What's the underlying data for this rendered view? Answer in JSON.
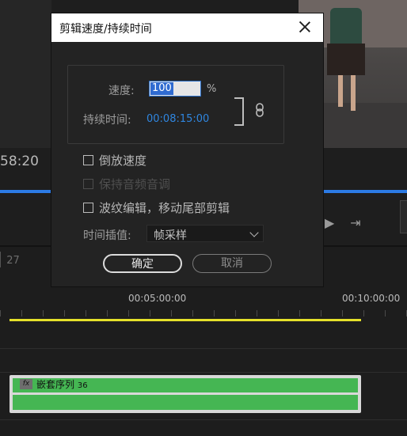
{
  "background": {
    "timecode": "58:20",
    "sequence_marker": "27",
    "ruler": {
      "mark1": "00:05:00:00",
      "mark2": "00:10:00:00"
    },
    "clip": {
      "fx": "fx",
      "name": "嵌套序列",
      "number": "36"
    },
    "colors": {
      "accent": "#2c7be5",
      "work_area": "#e5e02a",
      "clip": "#45b653"
    }
  },
  "dialog": {
    "title": "剪辑速度/持续时间",
    "speed_label": "速度:",
    "speed_value": "100",
    "percent": "%",
    "duration_label": "持续时间:",
    "duration_value": "00:08:15:00",
    "checkboxes": [
      {
        "label": "倒放速度",
        "checked": false,
        "enabled": true
      },
      {
        "label": "保持音频音调",
        "checked": false,
        "enabled": false
      },
      {
        "label": "波纹编辑，移动尾部剪辑",
        "checked": false,
        "enabled": true
      }
    ],
    "interpolation_label": "时间插值:",
    "interpolation_value": "帧采样",
    "ok_label": "确定",
    "cancel_label": "取消"
  }
}
